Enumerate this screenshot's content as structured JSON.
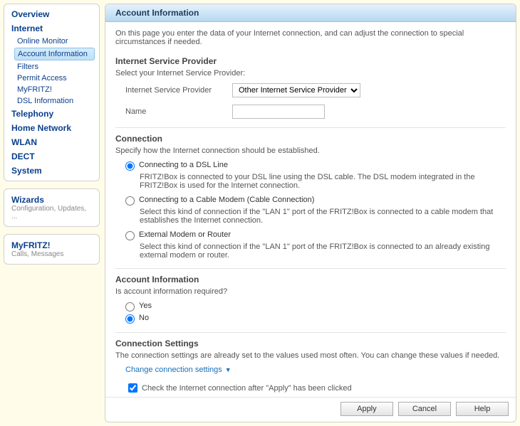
{
  "nav": {
    "overview": "Overview",
    "internet": "Internet",
    "internet_items": {
      "online_monitor": "Online Monitor",
      "account_info": "Account Information",
      "filters": "Filters",
      "permit_access": "Permit Access",
      "myfritz": "MyFRITZ!",
      "dsl_info": "DSL Information"
    },
    "telephony": "Telephony",
    "home_network": "Home Network",
    "wlan": "WLAN",
    "dect": "DECT",
    "system": "System"
  },
  "side_wizards": {
    "title": "Wizards",
    "sub": "Configuration, Updates, ..."
  },
  "side_myfritz": {
    "title": "MyFRITZ!",
    "sub": "Calls, Messages"
  },
  "page": {
    "title": "Account Information",
    "intro": "On this page you enter the data of your Internet connection, and can adjust the connection to special circumstances if needed."
  },
  "isp": {
    "section_title": "Internet Service Provider",
    "section_sub": "Select your Internet Service Provider:",
    "label_provider": "Internet Service Provider",
    "selected_value": "Other Internet Service Provider",
    "label_name": "Name",
    "name_value": ""
  },
  "connection": {
    "section_title": "Connection",
    "section_sub": "Specify how the Internet connection should be established.",
    "opt_dsl": {
      "label": "Connecting to a DSL Line",
      "desc": "FRITZ!Box is connected to your DSL line using the DSL cable. The DSL modem integrated in the FRITZ!Box is used for the Internet connection."
    },
    "opt_cable": {
      "label": "Connecting to a Cable Modem (Cable Connection)",
      "desc": "Select this kind of connection if the \"LAN 1\" port of the FRITZ!Box is connected to a cable modem that establishes the Internet connection."
    },
    "opt_ext": {
      "label": "External Modem or Router",
      "desc": "Select this kind of connection if the \"LAN 1\" port of the FRITZ!Box is connected to an already existing external modem or router."
    }
  },
  "account": {
    "section_title": "Account Information",
    "section_sub": "Is account information required?",
    "opt_yes": "Yes",
    "opt_no": "No"
  },
  "conn_settings": {
    "section_title": "Connection Settings",
    "section_sub": "The connection settings are already set to the values used most often. You can change these values if needed.",
    "expand_link": "Change connection settings",
    "check_label": "Check the Internet connection after \"Apply\" has been clicked"
  },
  "buttons": {
    "apply": "Apply",
    "cancel": "Cancel",
    "help": "Help"
  }
}
